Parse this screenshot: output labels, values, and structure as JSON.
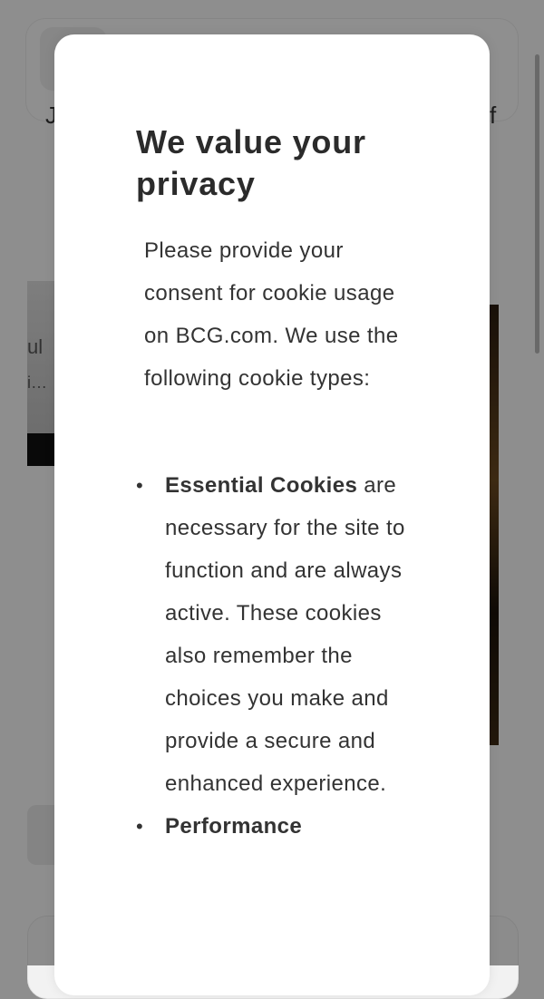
{
  "dialog": {
    "title": "We value your privacy",
    "intro": "Please provide your consent for cookie usage on BCG.com. We use the following cookie types:",
    "cookie_types": [
      {
        "name": "Essential Cookies",
        "description": " are necessary for the site to function and are always active. These cookies also remember the choices you make and provide a secure and enhanced experience."
      },
      {
        "name": "Performance",
        "description": ""
      }
    ],
    "bullet": "•"
  },
  "background": {
    "char_left": "J",
    "char_right": "f",
    "frag_line1": "ul",
    "frag_line2": "i…"
  },
  "colors": {
    "overlay": "#8e8e8e",
    "dialog_bg": "#ffffff",
    "text": "#333333"
  }
}
